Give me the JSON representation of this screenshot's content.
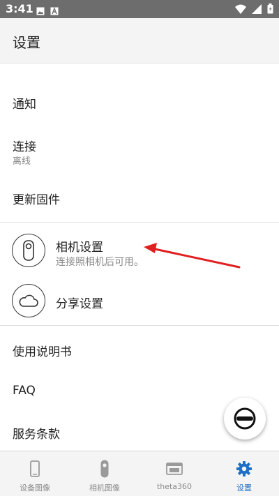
{
  "status_bar": {
    "time": "3:41",
    "left_icons": [
      "image-icon",
      "a-icon"
    ],
    "right_icons": [
      "wifi-icon",
      "signal-icon",
      "battery-icon"
    ]
  },
  "app_bar": {
    "title": "设置"
  },
  "settings": {
    "notifications": {
      "label": "通知"
    },
    "connection": {
      "label": "连接",
      "subtitle": "离线"
    },
    "update_firmware": {
      "label": "更新固件"
    },
    "camera_settings": {
      "label": "相机设置",
      "subtitle": "连接照相机后可用。",
      "icon": "camera-icon"
    },
    "share_settings": {
      "label": "分享设置",
      "icon": "cloud-icon"
    },
    "manual": {
      "label": "使用说明书"
    },
    "faq": {
      "label": "FAQ"
    },
    "terms": {
      "label": "服务条款"
    }
  },
  "fab": {
    "icon": "theta-camera-icon"
  },
  "bottom_nav": [
    {
      "label": "设备图像",
      "icon": "phone-icon",
      "active": false
    },
    {
      "label": "相机图像",
      "icon": "camera-icon",
      "active": false
    },
    {
      "label": "theta360",
      "icon": "browser-icon",
      "active": false
    },
    {
      "label": "设置",
      "icon": "gear-icon",
      "active": true
    }
  ],
  "colors": {
    "status_bar": "#6d6d6d",
    "app_bar": "#f4f4f4",
    "accent": "#1e6fc5",
    "annotation_arrow": "#e02020",
    "inactive_nav": "#8a8a8a"
  }
}
